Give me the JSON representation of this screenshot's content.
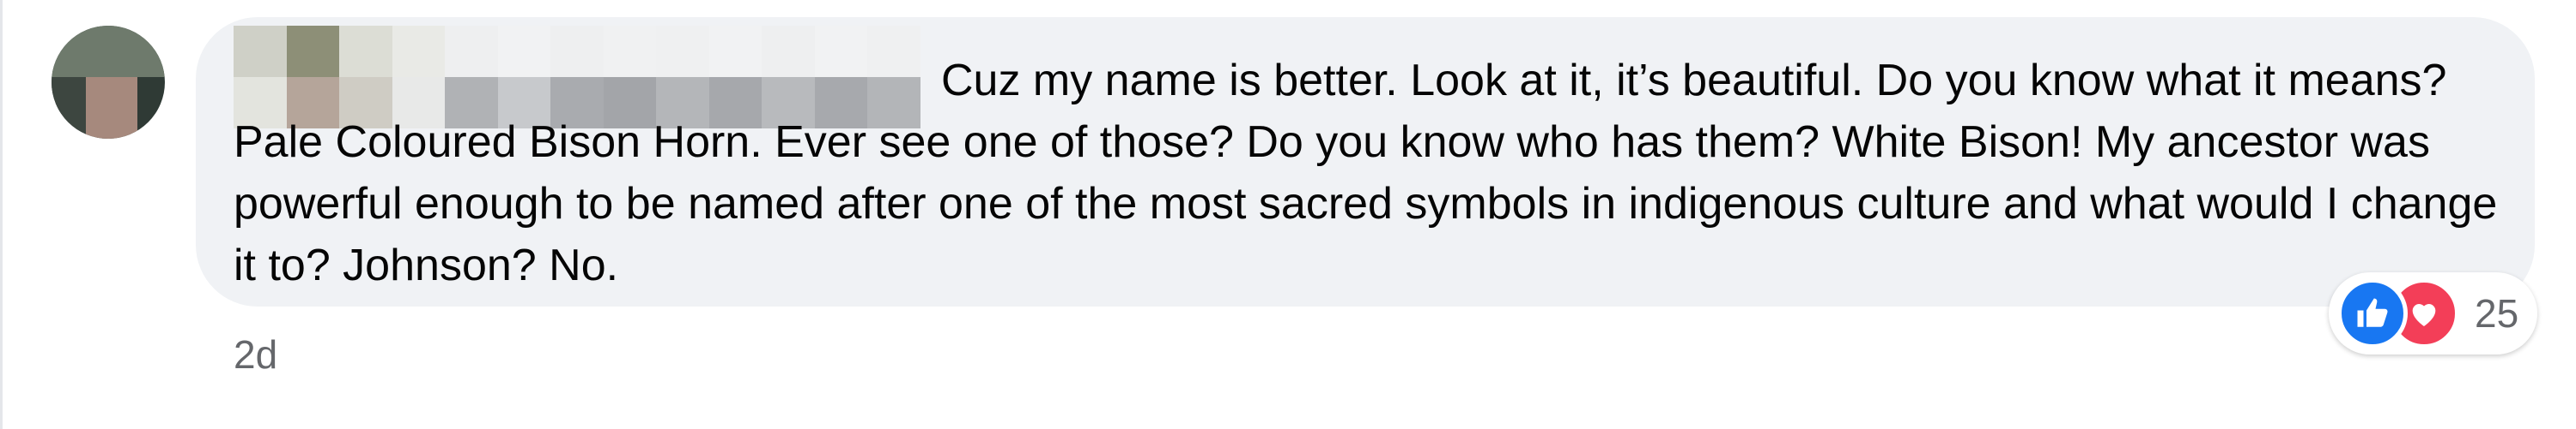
{
  "comment": {
    "text": "Cuz my name is better. Look at it, it’s beautiful. Do you know what it means? Pale Coloured Bison Horn. Ever see one of those? Do you know who has them? White Bison! My ancestor was powerful enough to be named after one of the most sacred symbols in indigenous culture and what would I change it to? Johnson? No.",
    "timestamp": "2d"
  },
  "reactions": {
    "count": "25",
    "icons": [
      "like-icon",
      "love-icon"
    ]
  },
  "colors": {
    "bubble": "#f0f2f5",
    "text": "#050505",
    "meta": "#65676b",
    "like": "#1877f2",
    "love": "#f33e58"
  }
}
